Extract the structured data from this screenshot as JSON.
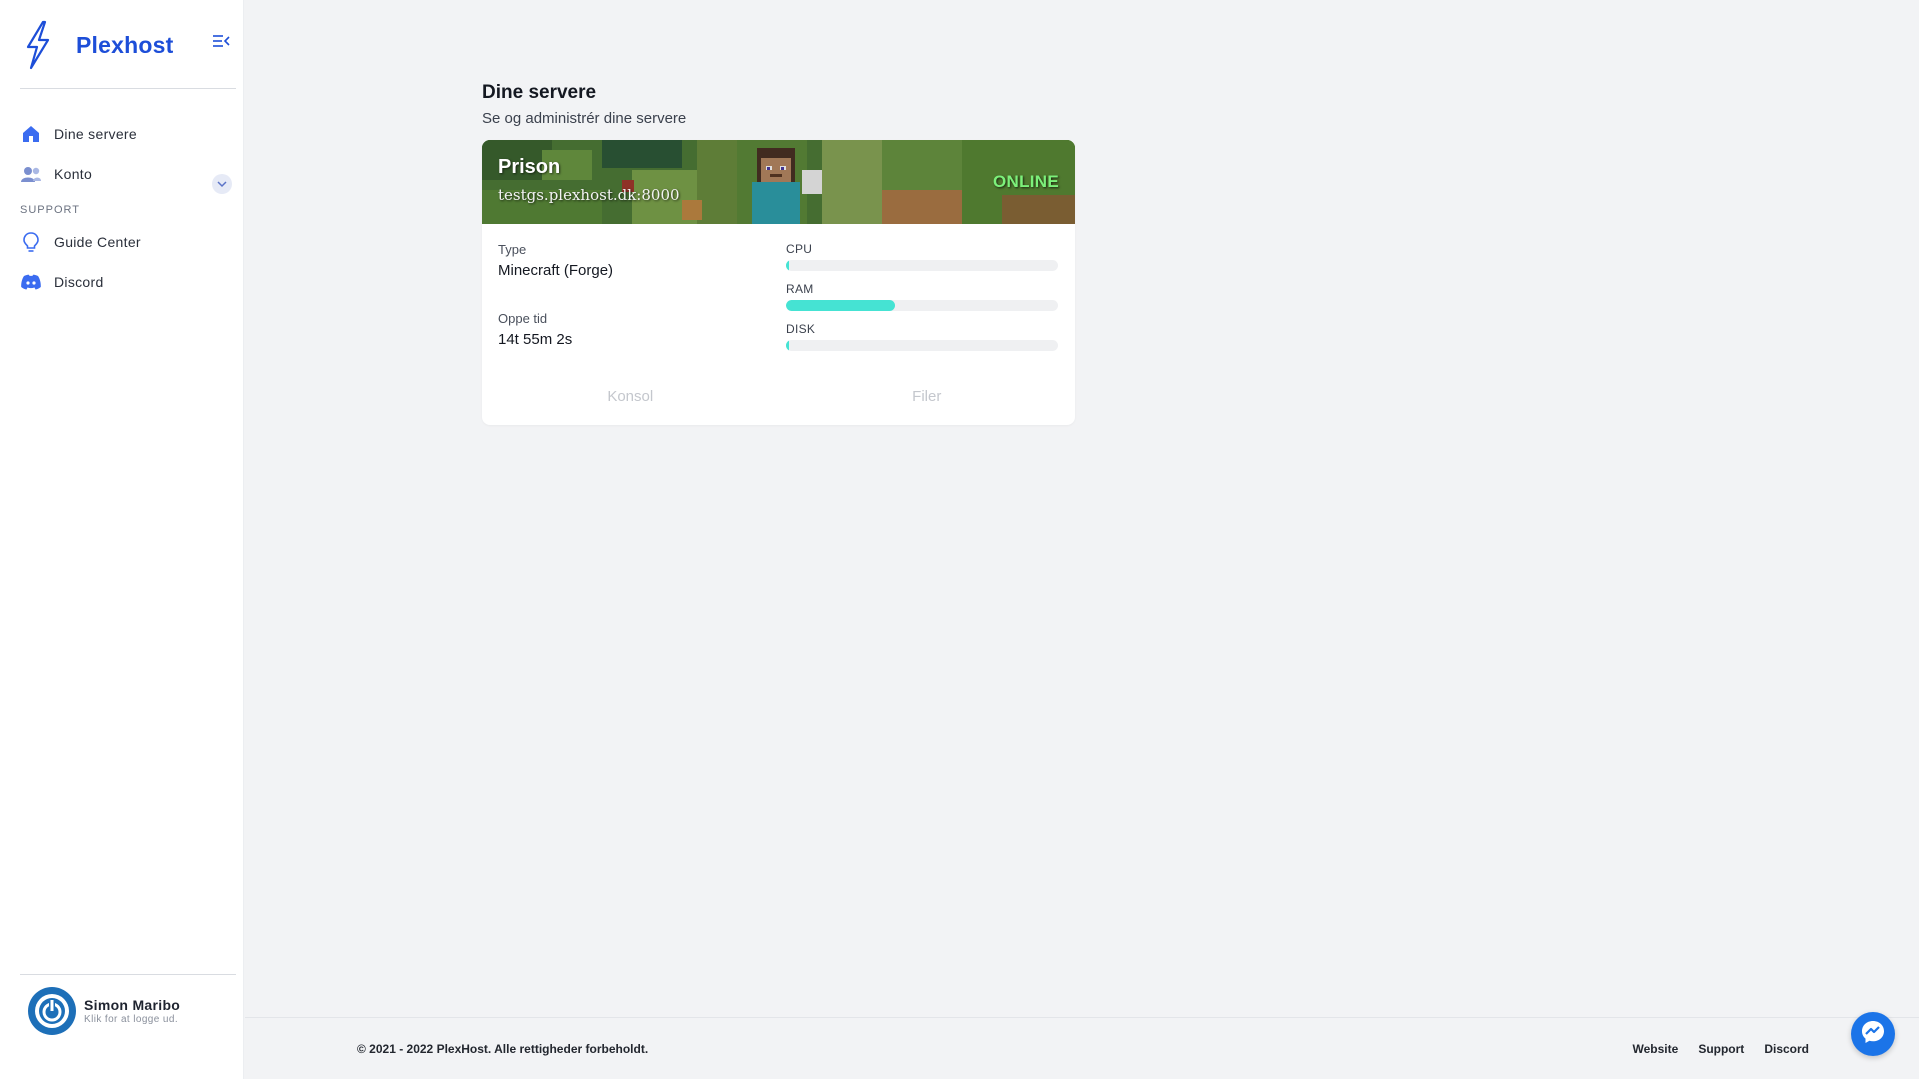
{
  "brand": {
    "name": "Plexhost",
    "logo_icon": "lightning-bolt-icon",
    "color": "#1d4ed8"
  },
  "sidebar": {
    "items": [
      {
        "label": "Dine servere",
        "icon": "home-icon"
      },
      {
        "label": "Konto",
        "icon": "users-icon"
      }
    ],
    "support_heading": "SUPPORT",
    "support_items": [
      {
        "label": "Guide Center",
        "icon": "lightbulb-icon"
      },
      {
        "label": "Discord",
        "icon": "discord-icon"
      }
    ]
  },
  "user": {
    "name": "Simon Maribo",
    "subtitle": "Klik for at logge ud."
  },
  "main": {
    "title": "Dine servere",
    "subtitle": "Se og administrér dine servere",
    "servers": [
      {
        "name": "Prison",
        "address": "testgs.plexhost.dk:8000",
        "status": "ONLINE",
        "status_color": "#7cf07a",
        "type_label": "Type",
        "type_value": "Minecraft (Forge)",
        "uptime_label": "Oppe tid",
        "uptime_value": "14t 55m 2s",
        "stats": [
          {
            "label": "CPU",
            "fraction": 0.005
          },
          {
            "label": "RAM",
            "fraction": 0.4
          },
          {
            "label": "DISK",
            "fraction": 0.012
          }
        ],
        "actions": {
          "console": "Konsol",
          "files": "Filer"
        }
      }
    ]
  },
  "footer": {
    "copyright": "© 2021 - 2022 PlexHost. Alle rettigheder forbeholdt.",
    "links": [
      "Website",
      "Support",
      "Discord"
    ]
  },
  "accent_color": "#45e3d3"
}
